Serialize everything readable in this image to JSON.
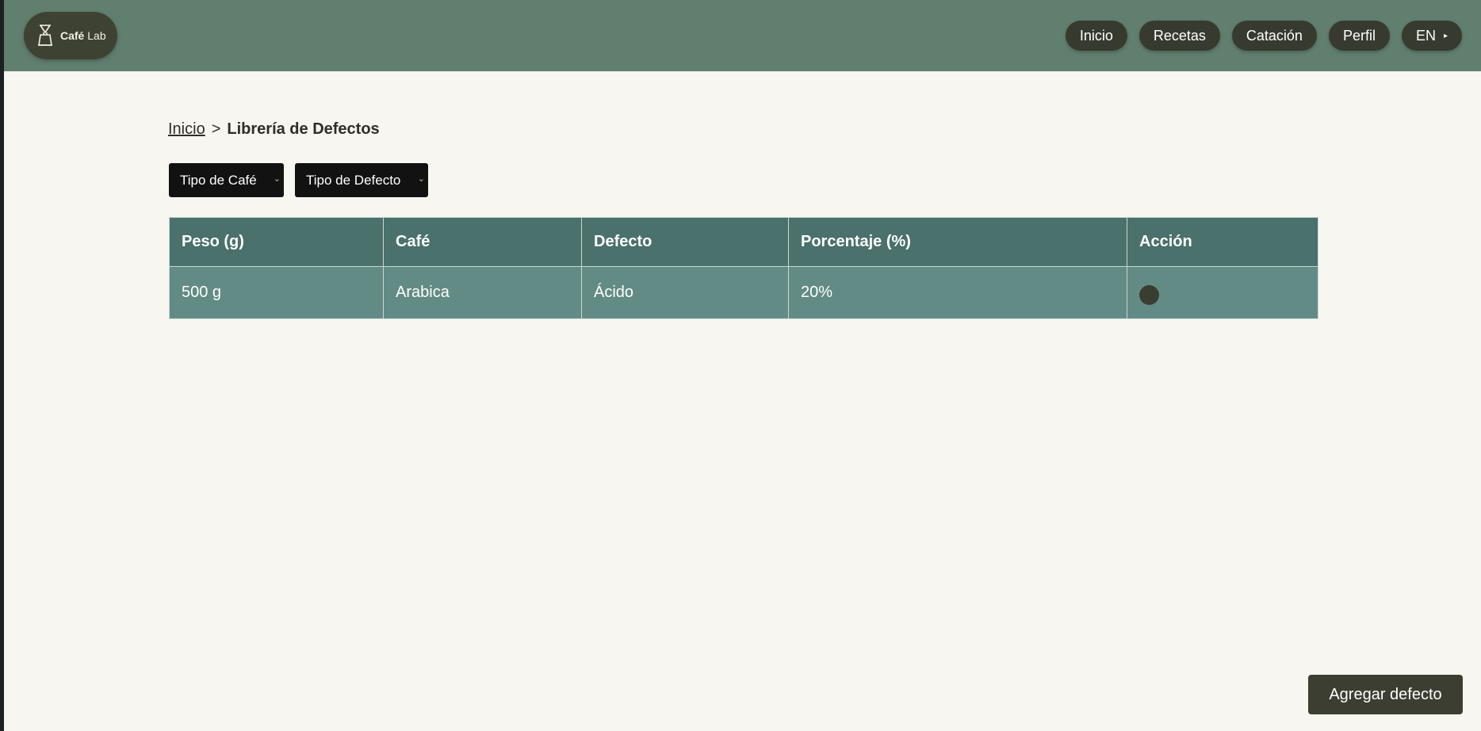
{
  "header": {
    "logo": {
      "bold": "Café",
      "text": " Lab",
      "icon": "coffee-dripper-icon"
    },
    "nav": [
      {
        "label": "Inicio"
      },
      {
        "label": "Recetas"
      },
      {
        "label": "Catación"
      },
      {
        "label": "Perfil"
      }
    ],
    "language": {
      "label": "EN",
      "arrow": "▸"
    }
  },
  "breadcrumb": {
    "home": "Inicio",
    "separator": ">",
    "current": "Librería de Defectos"
  },
  "filters": {
    "coffee_type": {
      "selected": "Tipo de Café"
    },
    "defect_type": {
      "selected": "Tipo de Defecto"
    }
  },
  "table": {
    "headers": [
      "Peso (g)",
      "Café",
      "Defecto",
      "Porcentaje (%)",
      "Acción"
    ],
    "rows": [
      {
        "weight": "500 g",
        "coffee": "Arabica",
        "defect": "Ácido",
        "percentage": "20%"
      }
    ]
  },
  "actions": {
    "add_label": "Agregar defecto"
  },
  "colors": {
    "header_bg": "#617f6f",
    "page_bg": "#f7f6f1",
    "table_header": "#4a716c",
    "table_row": "#638b86",
    "dark_button": "#373a2f"
  }
}
